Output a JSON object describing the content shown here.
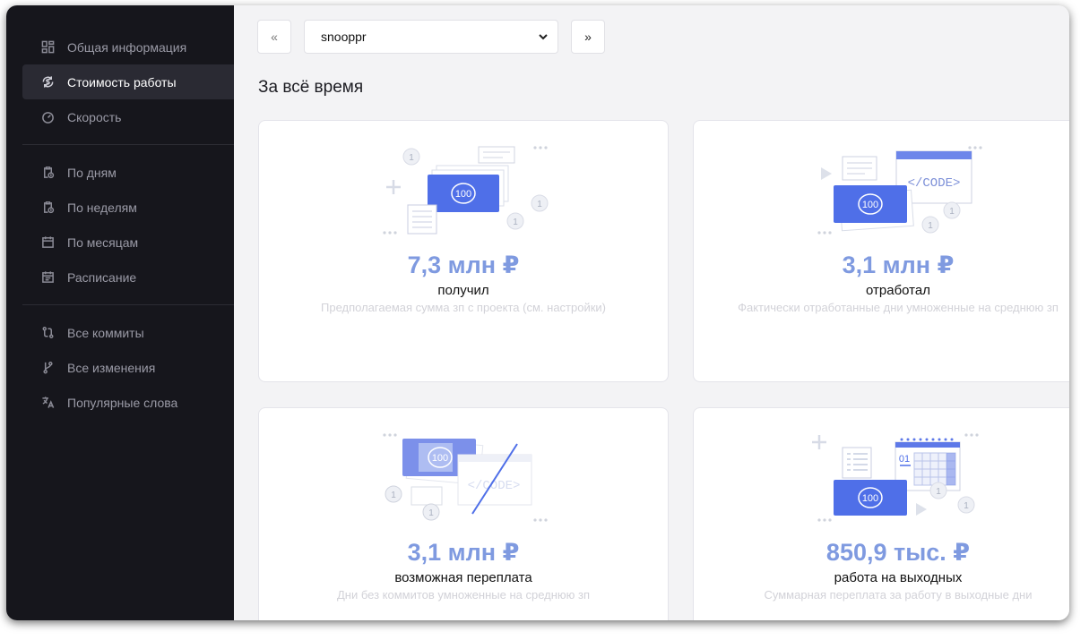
{
  "sidebar": {
    "items": [
      {
        "label": "Общая информация",
        "icon": "dashboard-icon"
      },
      {
        "label": "Стоимость работы",
        "icon": "money-cycle-icon",
        "active": true
      },
      {
        "label": "Скорость",
        "icon": "speedometer-icon"
      },
      {
        "label": "По дням",
        "icon": "clipboard-clock-icon"
      },
      {
        "label": "По неделям",
        "icon": "clipboard-clock-icon"
      },
      {
        "label": "По месяцам",
        "icon": "calendar-icon"
      },
      {
        "label": "Расписание",
        "icon": "schedule-icon"
      },
      {
        "label": "Все коммиты",
        "icon": "git-compare-icon"
      },
      {
        "label": "Все изменения",
        "icon": "git-branch-icon"
      },
      {
        "label": "Популярные слова",
        "icon": "translate-icon"
      }
    ]
  },
  "toolbar": {
    "prev_label": "«",
    "next_label": "»",
    "user_select_value": "snooppr"
  },
  "page": {
    "period_title": "За всё время"
  },
  "cards": [
    {
      "value": "7,3 млн ₽",
      "label": "получил",
      "description": "Предполагаемая сумма зп с проекта (см. настройки)"
    },
    {
      "value": "3,1 млн ₽",
      "label": "отработал",
      "description": "Фактически отработанные дни умноженные на среднюю зп"
    },
    {
      "value": "3,1 млн ₽",
      "label": "возможная переплата",
      "description": "Дни без коммитов умноженные на среднюю зп"
    },
    {
      "value": "850,9 тыс. ₽",
      "label": "работа на выходных",
      "description": "Суммарная переплата за работу в выходные дни"
    }
  ],
  "illustration": {
    "banknote_text": "100",
    "code_text": "</CODE>",
    "coin_text": "1",
    "calendar_text": "01"
  },
  "colors": {
    "sidebar_bg": "#16161c",
    "accent": "#7f9ae0",
    "banknote": "#4f6fe8"
  }
}
